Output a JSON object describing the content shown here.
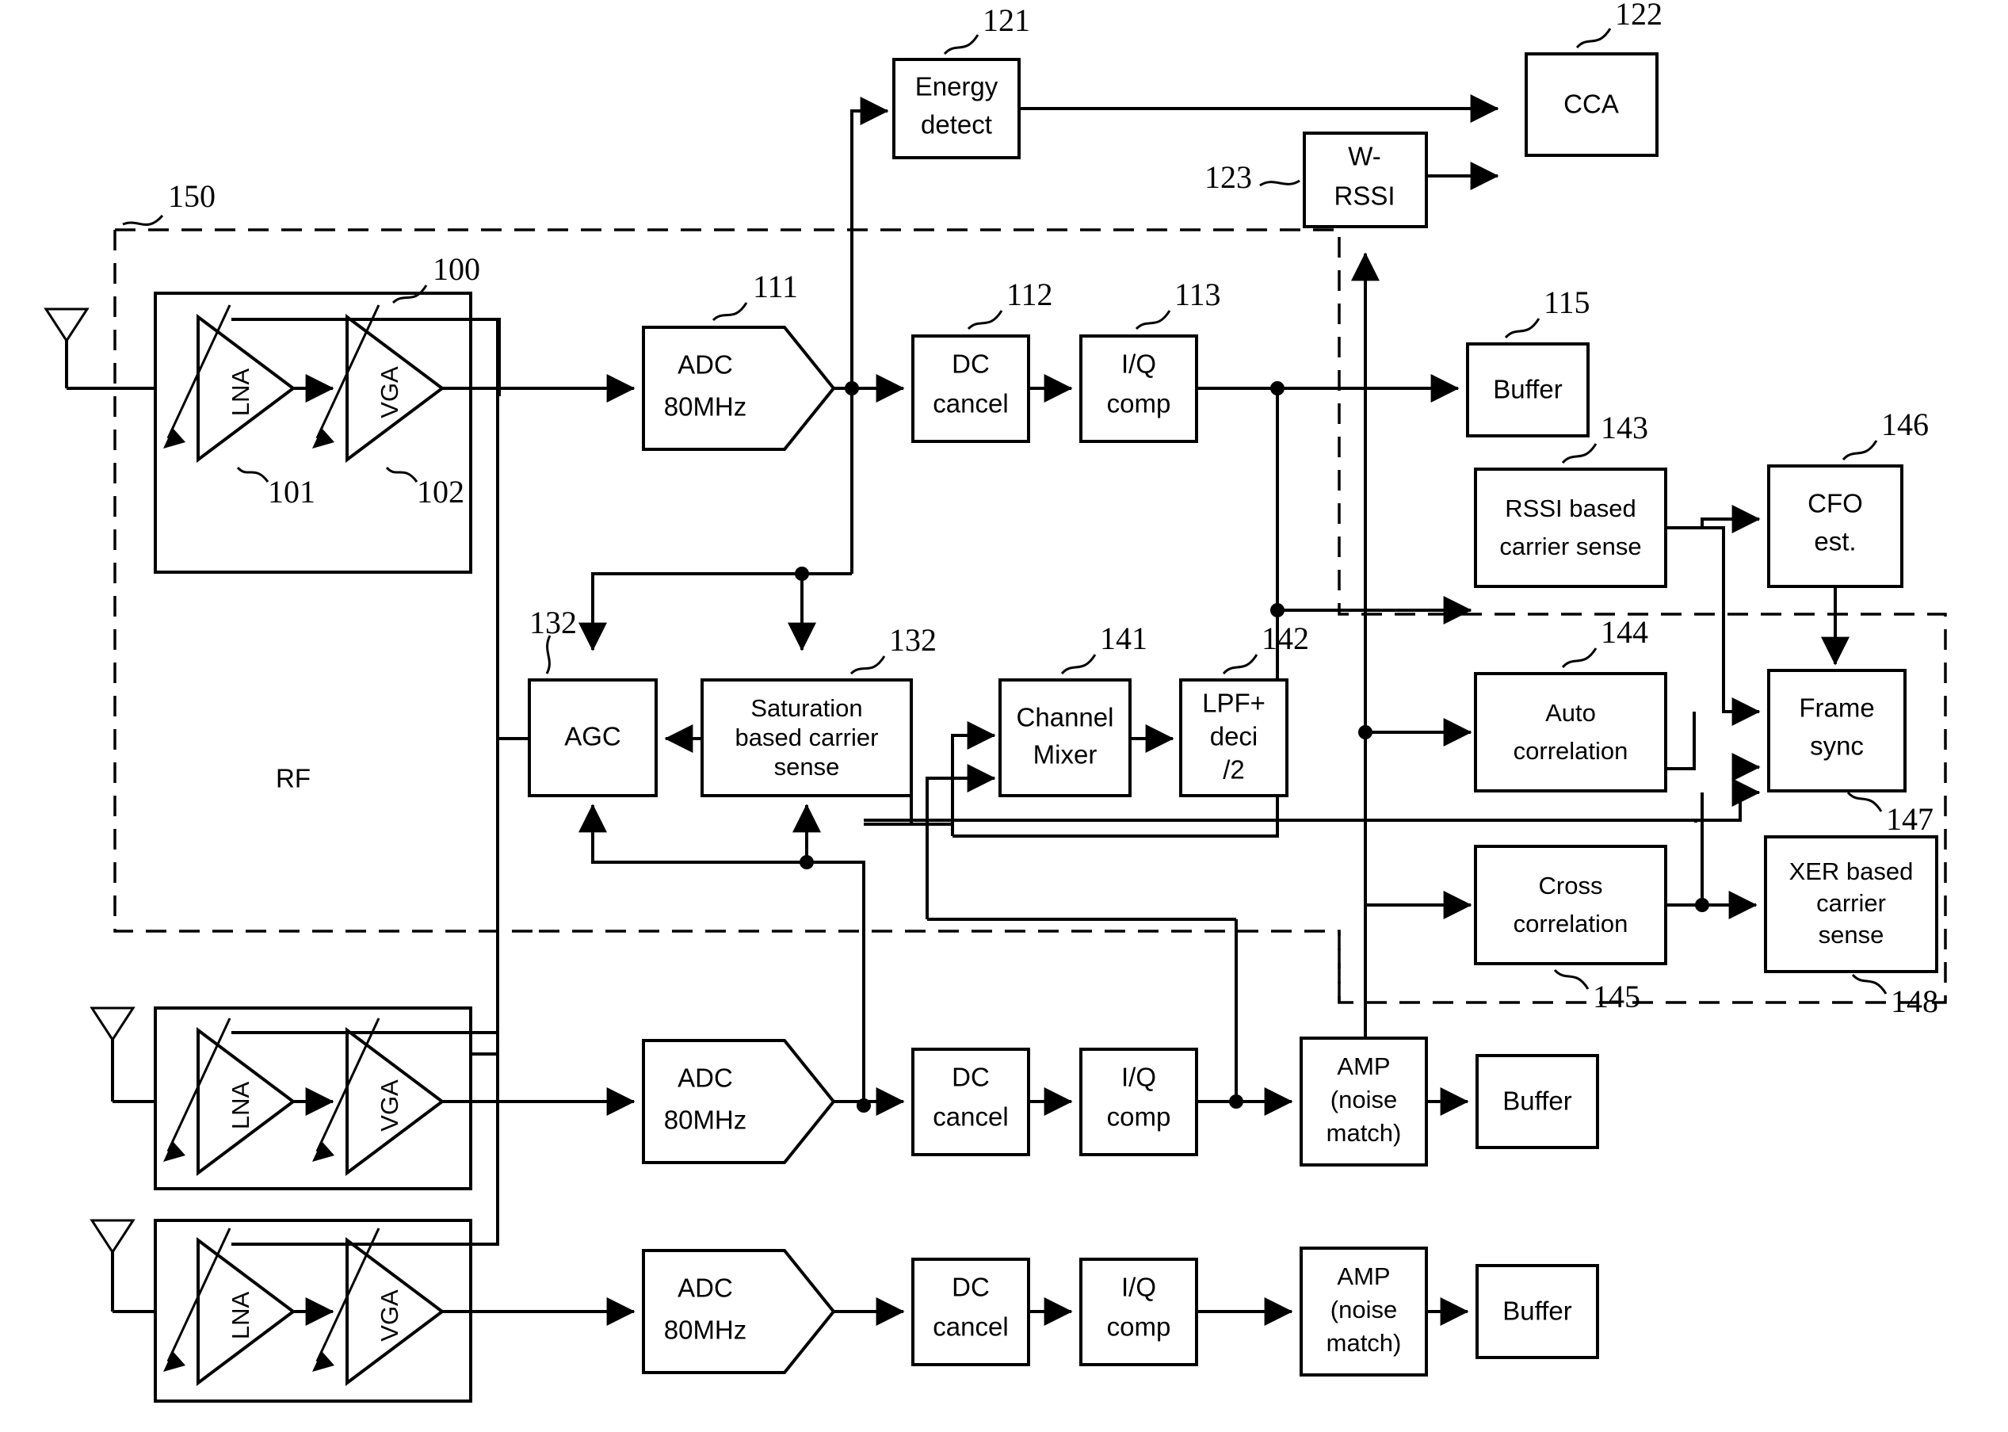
{
  "figure": {
    "type": "patent-block-diagram",
    "title": "RF receiver front-end block diagram with carrier sense paths"
  },
  "blocks": {
    "energy_detect": {
      "label_line1": "Energy",
      "label_line2": "detect",
      "ref": "121"
    },
    "cca": {
      "label_line1": "CCA",
      "ref": "122"
    },
    "w_rssi": {
      "label_line1": "W-",
      "label_line2": "RSSI",
      "ref": "123"
    },
    "adc1": {
      "label_line1": "ADC",
      "label_line2": "80MHz",
      "ref": "111"
    },
    "adc2": {
      "label_line1": "ADC",
      "label_line2": "80MHz"
    },
    "adc3": {
      "label_line1": "ADC",
      "label_line2": "80MHz"
    },
    "dc_cancel1": {
      "label_line1": "DC",
      "label_line2": "cancel",
      "ref": "112"
    },
    "dc_cancel2": {
      "label_line1": "DC",
      "label_line2": "cancel"
    },
    "dc_cancel3": {
      "label_line1": "DC",
      "label_line2": "cancel"
    },
    "iq_comp1": {
      "label_line1": "I/Q",
      "label_line2": "comp",
      "ref": "113"
    },
    "iq_comp2": {
      "label_line1": "I/Q",
      "label_line2": "comp"
    },
    "iq_comp3": {
      "label_line1": "I/Q",
      "label_line2": "comp"
    },
    "buffer1": {
      "label_line1": "Buffer",
      "ref": "115"
    },
    "buffer2": {
      "label_line1": "Buffer"
    },
    "buffer3": {
      "label_line1": "Buffer"
    },
    "amp2": {
      "label_line1": "AMP",
      "label_line2": "(noise",
      "label_line3": "match)"
    },
    "amp3": {
      "label_line1": "AMP",
      "label_line2": "(noise",
      "label_line3": "match)"
    },
    "agc": {
      "label_line1": "AGC",
      "ref": "132"
    },
    "sat_cs": {
      "label_line1": "Saturation",
      "label_line2": "based carrier",
      "label_line3": "sense",
      "ref": "132"
    },
    "channel_mixer": {
      "label_line1": "Channel",
      "label_line2": "Mixer",
      "ref": "141"
    },
    "lpf_deci": {
      "label_line1": "LPF+",
      "label_line2": "deci",
      "label_line3": "/2",
      "ref": "142"
    },
    "rssi_cs": {
      "label_line1": "RSSI based",
      "label_line2": "carrier sense",
      "ref": "143"
    },
    "auto_corr": {
      "label_line1": "Auto",
      "label_line2": "correlation",
      "ref": "144"
    },
    "cross_corr": {
      "label_line1": "Cross",
      "label_line2": "correlation",
      "ref": "145"
    },
    "cfo_est": {
      "label_line1": "CFO",
      "label_line2": "est.",
      "ref": "146"
    },
    "frame_sync": {
      "label_line1": "Frame",
      "label_line2": "sync",
      "ref": "147"
    },
    "xer_cs": {
      "label_line1": "XER based",
      "label_line2": "carrier",
      "label_line3": "sense",
      "ref": "148"
    },
    "lna1": {
      "label": "LNA",
      "ref": "101"
    },
    "vga1": {
      "label": "VGA",
      "ref": "102"
    },
    "lna2": {
      "label": "LNA"
    },
    "vga2": {
      "label": "VGA"
    },
    "lna3": {
      "label": "LNA"
    },
    "vga3": {
      "label": "VGA"
    }
  },
  "regions": {
    "rf_boundary": {
      "ref": "150",
      "label": "RF"
    },
    "frontend_box": {
      "ref": "100"
    }
  },
  "reference_numerals": [
    "100",
    "101",
    "102",
    "111",
    "112",
    "113",
    "115",
    "121",
    "122",
    "123",
    "132",
    "132",
    "141",
    "142",
    "143",
    "144",
    "145",
    "146",
    "147",
    "148",
    "150"
  ],
  "icons": {
    "antenna": "antenna-icon",
    "gain_arrow": "gain-control-arrow-icon",
    "signal_arrow": "signal-flow-arrow-icon",
    "junction": "wire-junction-dot-icon"
  },
  "colors": {
    "stroke": "#000000",
    "fill": "#ffffff"
  }
}
